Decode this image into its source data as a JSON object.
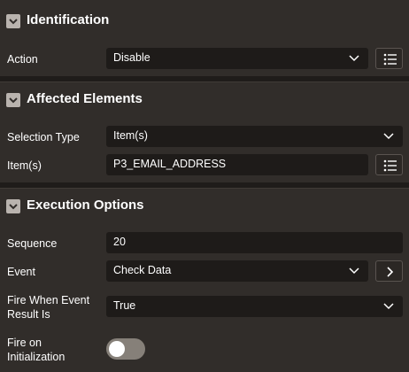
{
  "sections": {
    "identification": {
      "title": "Identification",
      "action_label": "Action",
      "action_value": "Disable"
    },
    "affected": {
      "title": "Affected Elements",
      "selection_type_label": "Selection Type",
      "selection_type_value": "Item(s)",
      "items_label": "Item(s)",
      "items_value": "P3_EMAIL_ADDRESS"
    },
    "execution": {
      "title": "Execution Options",
      "sequence_label": "Sequence",
      "sequence_value": "20",
      "event_label": "Event",
      "event_value": "Check Data",
      "fire_when_label_line1": "Fire When Event",
      "fire_when_label_line2": "Result Is",
      "fire_when_value": "True",
      "fire_on_init_label_line1": "Fire on",
      "fire_on_init_label_line2": "Initialization",
      "fire_on_init_on": false
    }
  },
  "icons": {
    "collapse": "chevron-down-icon",
    "select": "chevron-down-icon",
    "list": "list-icon",
    "arrow": "chevron-right-icon"
  },
  "colors": {
    "background": "#312d2a",
    "field": "#1e1b19",
    "toggle_off": "#868079"
  }
}
